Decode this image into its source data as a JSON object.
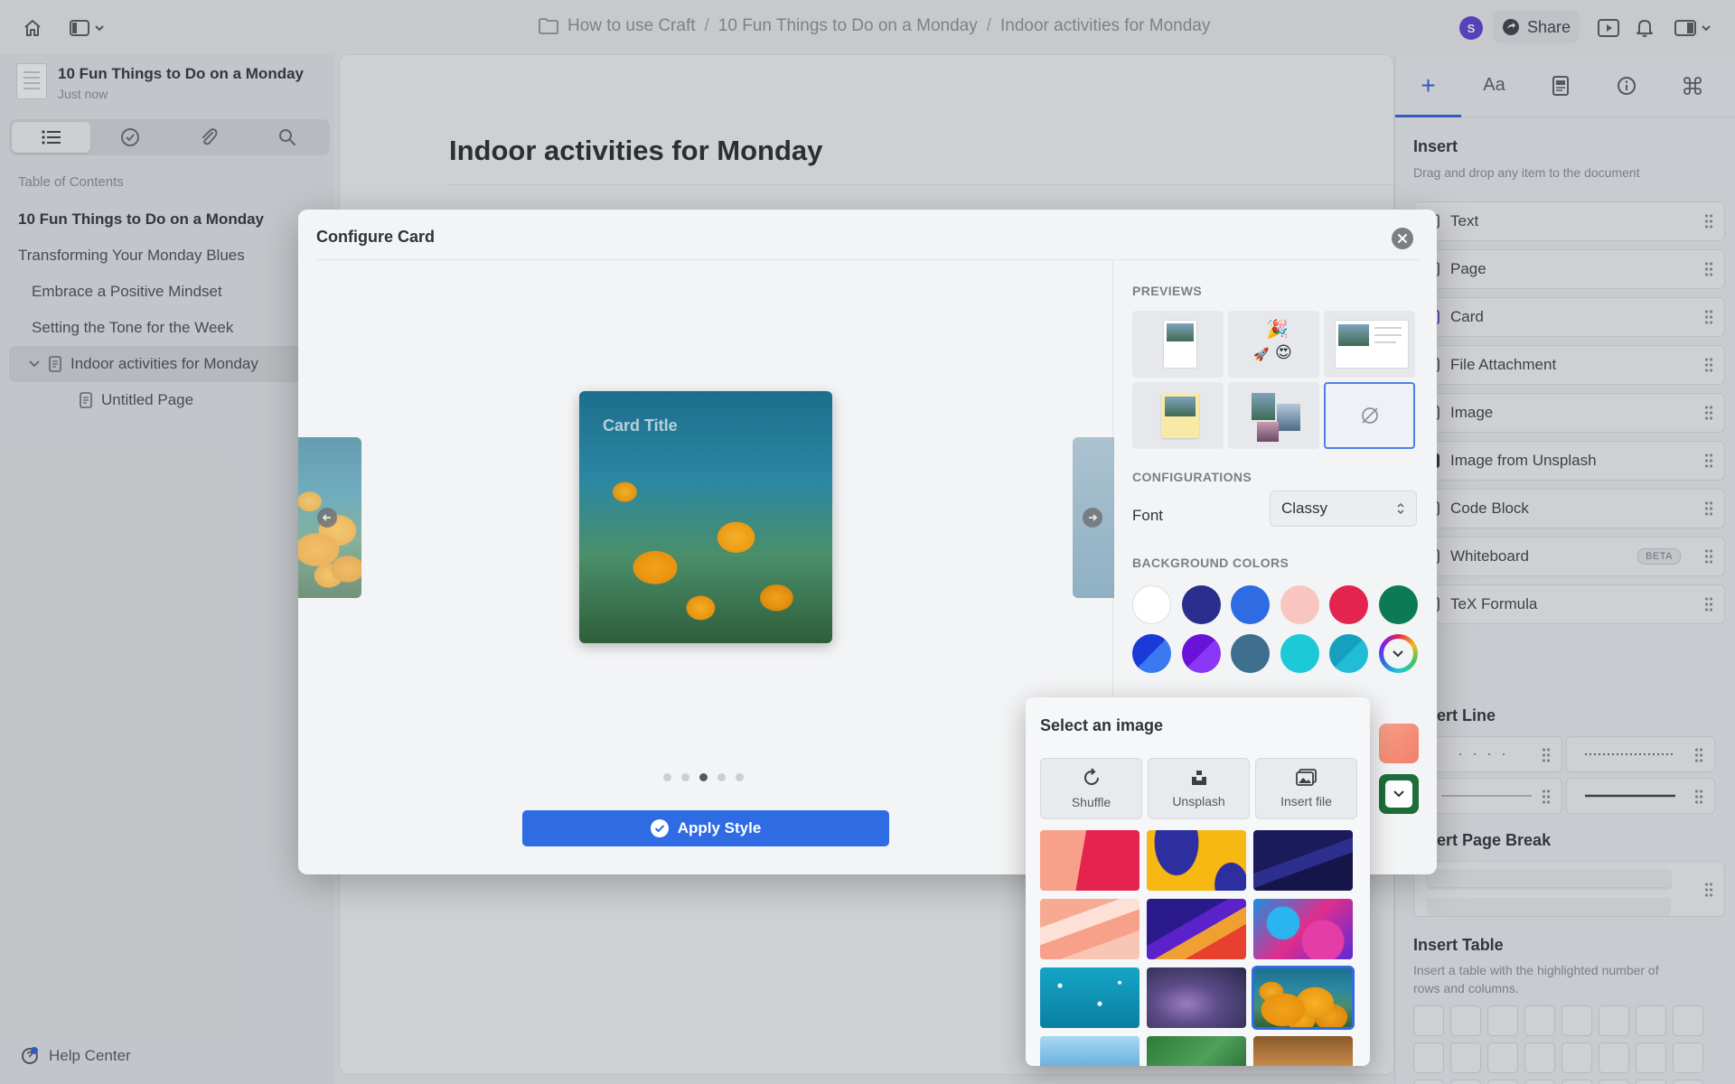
{
  "topbar": {
    "breadcrumb": [
      "How to use Craft",
      "10 Fun Things to Do on a Monday",
      "Indoor activities for Monday"
    ],
    "avatar_initial": "S",
    "share_label": "Share"
  },
  "sidebar": {
    "doc_title": "10 Fun Things to Do on a Monday",
    "doc_status": "Just now",
    "tabs": [
      "outline-icon",
      "check-icon",
      "paperclip-icon",
      "search-icon"
    ],
    "toc_label": "Table of Contents",
    "toc": [
      {
        "label": "10 Fun Things to Do on a Monday"
      },
      {
        "label": "Transforming Your Monday Blues"
      },
      {
        "label": "Embrace a Positive Mindset"
      },
      {
        "label": "Setting the Tone for the Week"
      },
      {
        "label": "Indoor activities for Monday"
      },
      {
        "label": "Untitled Page"
      }
    ],
    "help_label": "Help Center"
  },
  "document": {
    "title": "Indoor activities for Monday"
  },
  "right_panel": {
    "tabs": [
      "+",
      "Aa",
      "page-style-icon",
      "info-icon",
      "command-icon"
    ],
    "insert_title": "Insert",
    "insert_subtitle": "Drag and drop any item to the document",
    "items": [
      {
        "label": "Text"
      },
      {
        "label": "Page"
      },
      {
        "label": "Card"
      },
      {
        "label": "File Attachment"
      },
      {
        "label": "Image"
      },
      {
        "label": "Image from Unsplash"
      },
      {
        "label": "Code Block"
      },
      {
        "label": "Whiteboard",
        "badge": "BETA"
      },
      {
        "label": "TeX Formula"
      }
    ],
    "insert_line_title": "Insert Line",
    "insert_page_break_title": "Insert Page Break",
    "insert_table_title": "Insert Table",
    "insert_table_desc_1": "Insert a table with the highlighted number of",
    "insert_table_desc_2": "rows and columns."
  },
  "modal": {
    "title": "Configure Card",
    "card_title": "Card Title",
    "carousel_pages": 5,
    "carousel_active": 3,
    "apply_label": "Apply Style",
    "previews_label": "PREVIEWS",
    "configurations_label": "CONFIGURATIONS",
    "font_label": "Font",
    "font_value": "Classy",
    "bg_colors_label": "BACKGROUND COLORS",
    "swatches": [
      "#ffffff",
      "#2a2f8e",
      "#2f6be3",
      "#f8c6be",
      "#e3244f",
      "#0b7a55",
      "#2b5bf0",
      "#7b1ef0",
      "#3f6f8e",
      "#1cc9d6",
      "#1aa9c8",
      "color-wheel"
    ]
  },
  "image_popover": {
    "title": "Select an image",
    "buttons": [
      {
        "label": "Shuffle",
        "icon": "refresh-icon"
      },
      {
        "label": "Unsplash",
        "icon": "unsplash-icon"
      },
      {
        "label": "Insert file",
        "icon": "image-icon"
      }
    ]
  },
  "colors": {
    "accent": "#2f6be3"
  }
}
